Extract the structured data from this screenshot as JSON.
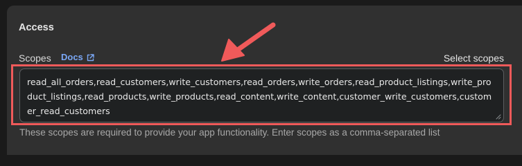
{
  "access": {
    "title": "Access",
    "scopes_label": "Scopes",
    "docs_label": "Docs",
    "select_scopes_label": "Select scopes",
    "scopes_value": "read_all_orders,read_customers,write_customers,read_orders,write_orders,read_product_listings,write_product_listings,read_products,write_products,read_content,write_content,customer_write_customers,customer_read_customers",
    "helper_text": "These scopes are required to provide your app functionality. Enter scopes as a comma-separated list"
  },
  "colors": {
    "annotation_red": "#f05a5a",
    "link_blue": "#7aa7f5",
    "card_bg": "#303030"
  },
  "icons": {
    "docs": "external-link-icon",
    "resize": "resize-grip-icon",
    "annotation": "arrow-pointer-icon"
  }
}
